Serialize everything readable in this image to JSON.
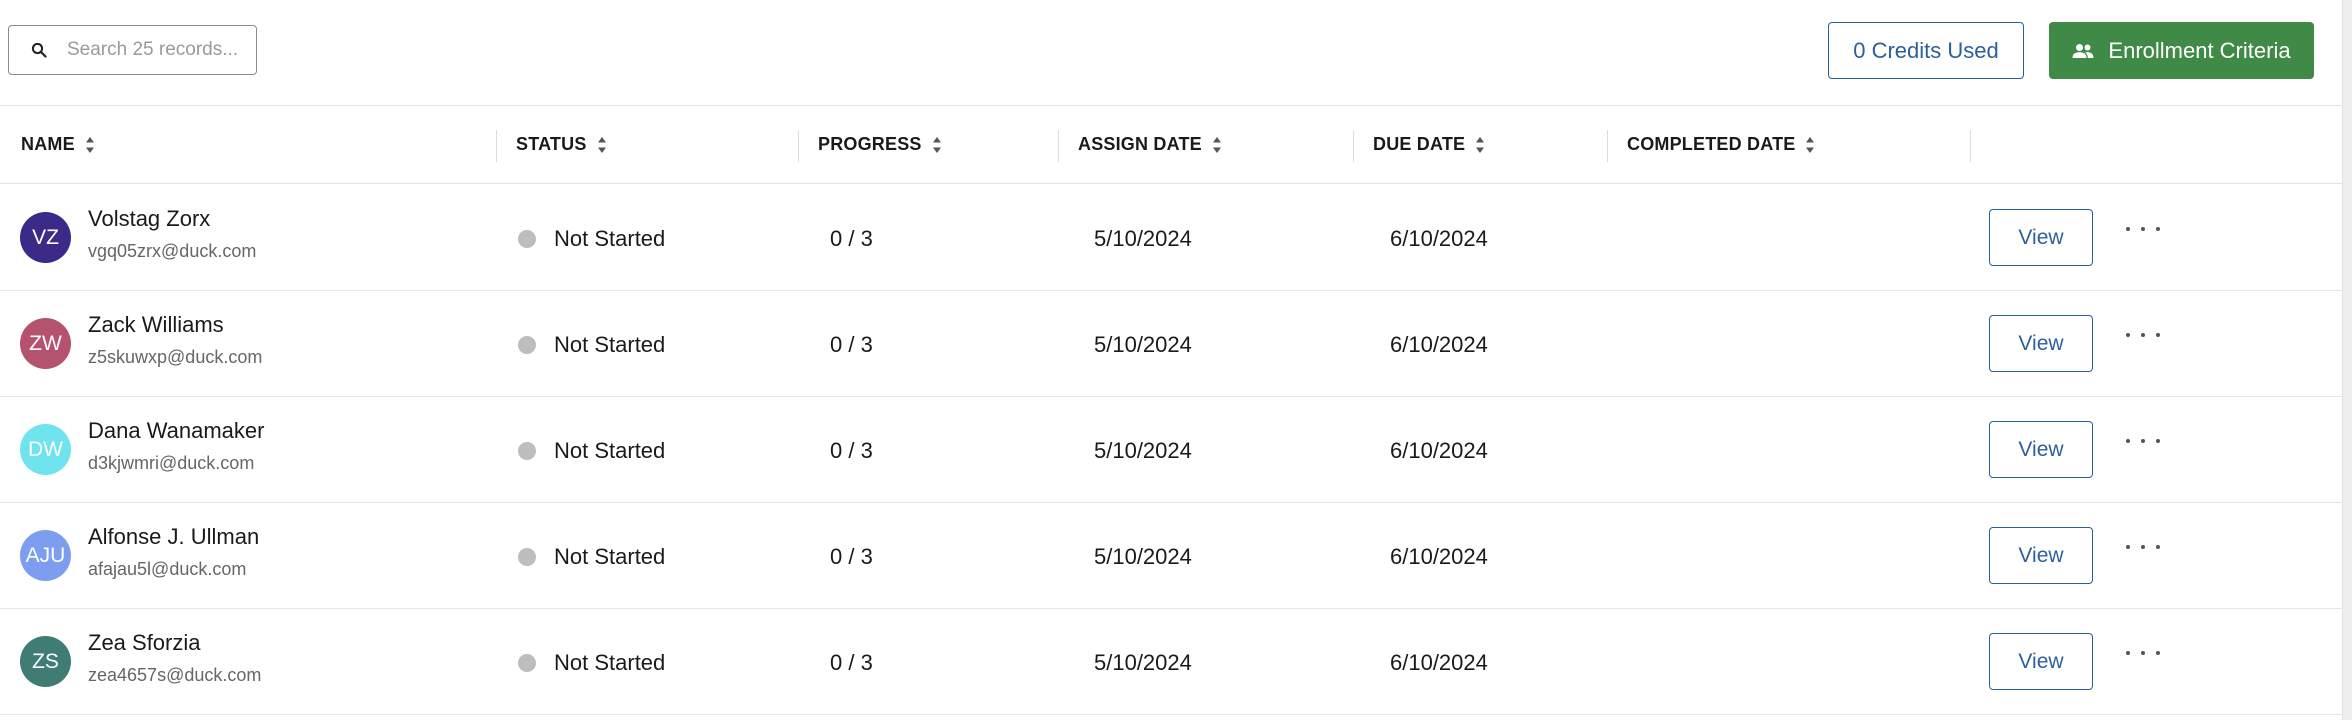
{
  "toolbar": {
    "search_placeholder": "Search 25 records...",
    "credits_label": "0 Credits Used",
    "enroll_label": "Enrollment Criteria",
    "accent_green": "#3f8a46",
    "accent_blue": "#2c5f9e"
  },
  "table": {
    "columns": [
      "NAME",
      "STATUS",
      "PROGRESS",
      "ASSIGN DATE",
      "DUE DATE",
      "COMPLETED DATE"
    ],
    "view_label": "View",
    "rows": [
      {
        "initials": "VZ",
        "avatar_color": "#3b2a88",
        "name": "Volstag Zorx",
        "email": "vgq05zrx@duck.com",
        "status": "Not Started",
        "progress": "0 / 3",
        "assign_date": "5/10/2024",
        "due_date": "6/10/2024",
        "completed_date": ""
      },
      {
        "initials": "ZW",
        "avatar_color": "#b5526e",
        "name": "Zack Williams",
        "email": "z5skuwxp@duck.com",
        "status": "Not Started",
        "progress": "0 / 3",
        "assign_date": "5/10/2024",
        "due_date": "6/10/2024",
        "completed_date": ""
      },
      {
        "initials": "DW",
        "avatar_color": "#6fe3ee",
        "name": "Dana Wanamaker",
        "email": "d3kjwmri@duck.com",
        "status": "Not Started",
        "progress": "0 / 3",
        "assign_date": "5/10/2024",
        "due_date": "6/10/2024",
        "completed_date": ""
      },
      {
        "initials": "AJU",
        "avatar_color": "#7d9ef0",
        "name": "Alfonse J. Ullman",
        "email": "afajau5l@duck.com",
        "status": "Not Started",
        "progress": "0 / 3",
        "assign_date": "5/10/2024",
        "due_date": "6/10/2024",
        "completed_date": ""
      },
      {
        "initials": "ZS",
        "avatar_color": "#3e7c74",
        "name": "Zea Sforzia",
        "email": "zea4657s@duck.com",
        "status": "Not Started",
        "progress": "0 / 3",
        "assign_date": "5/10/2024",
        "due_date": "6/10/2024",
        "completed_date": ""
      }
    ]
  }
}
